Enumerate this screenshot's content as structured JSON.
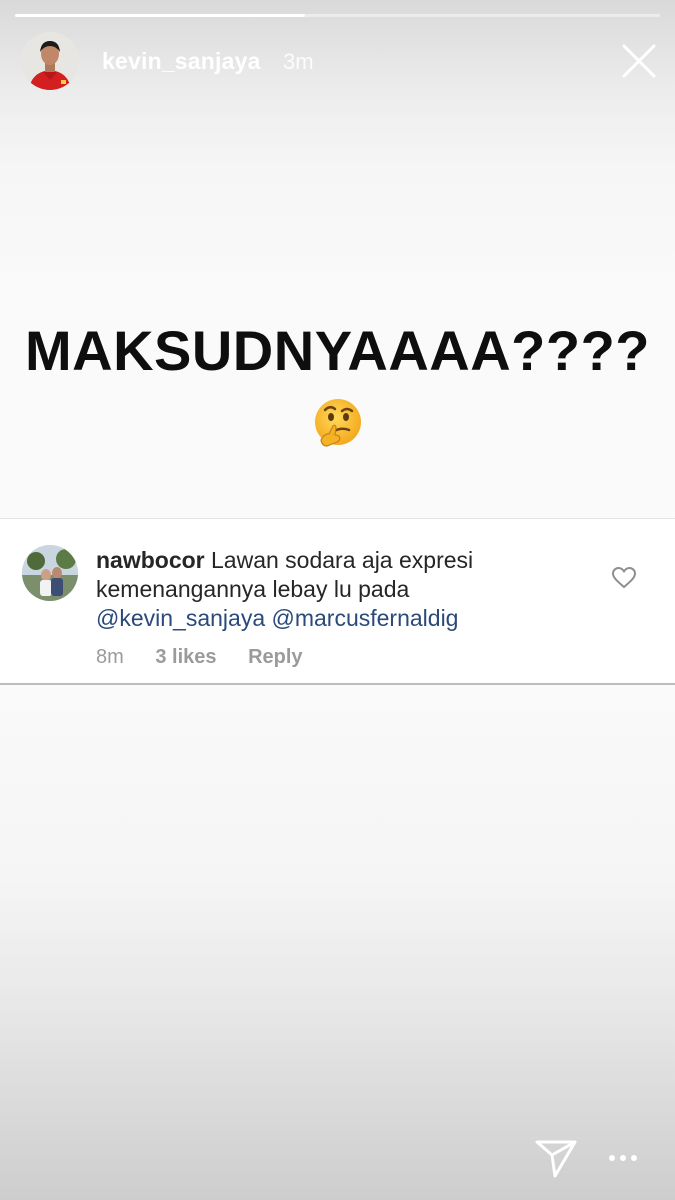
{
  "story": {
    "progress": 0.45,
    "username": "kevin_sanjaya",
    "time_ago": "3m",
    "headline": "MAKSUDNYAAAA????",
    "emoji": "thinking-face-emoji"
  },
  "comment": {
    "username": "nawbocor",
    "text": "Lawan sodara aja expresi kemenangannya lebay lu pada",
    "mention_1": "@kevin_sanjaya",
    "mention_2": "@marcusfernaldig",
    "time": "8m",
    "likes": "3 likes",
    "reply_label": "Reply"
  },
  "icons": {
    "close": "close-icon",
    "like": "heart-icon",
    "send": "send-icon",
    "more": "more-icon"
  },
  "colors": {
    "mention": "#2a4a7a",
    "headline": "#0e0e0e",
    "meta": "#9b9b9b"
  }
}
